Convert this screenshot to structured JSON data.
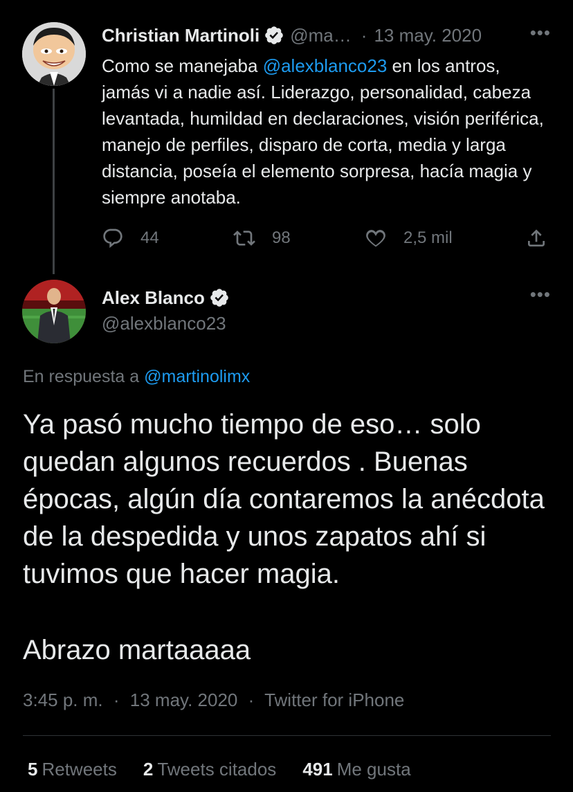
{
  "parent_tweet": {
    "author_name": "Christian Martinoli",
    "handle": "@ma…",
    "date": "13 may. 2020",
    "text_before": "Como se manejaba ",
    "mention": "@alexblanco23",
    "text_after": " en los antros, jamás vi a nadie así. Liderazgo, personalidad, cabeza levantada, humildad en  declaraciones, visión periférica, manejo de perfiles, disparo de corta, media y larga distancia, poseía el elemento sorpresa, hacía magia y siempre anotaba.",
    "replies": "44",
    "retweets": "98",
    "likes": "2,5 mil"
  },
  "reply_tweet": {
    "author_name": "Alex Blanco",
    "handle": "@alexblanco23",
    "reply_prefix": "En respuesta a ",
    "reply_mention": "@martinolimx",
    "text": "Ya pasó mucho tiempo de eso… solo quedan algunos recuerdos . Buenas épocas, algún día contaremos la anécdota de la despedida y unos zapatos ahí si tuvimos que hacer magia.",
    "text_line2": "Abrazo martaaaaa",
    "time": "3:45 p. m.",
    "date": "13 may. 2020",
    "source": "Twitter for iPhone",
    "retweets_count": "5",
    "retweets_label": "Retweets",
    "quotes_count": "2",
    "quotes_label": "Tweets citados",
    "likes_count": "491",
    "likes_label": "Me gusta"
  },
  "ui": {
    "more_label": "•••",
    "dot": "·"
  },
  "colors": {
    "background": "#000000",
    "text": "#e7e9ea",
    "secondary": "#71767b",
    "link": "#1d9bf0",
    "verified": "#e7e9ea"
  },
  "icons": [
    "reply-icon",
    "retweet-icon",
    "like-icon",
    "share-icon",
    "verified-badge-icon",
    "more-icon"
  ]
}
